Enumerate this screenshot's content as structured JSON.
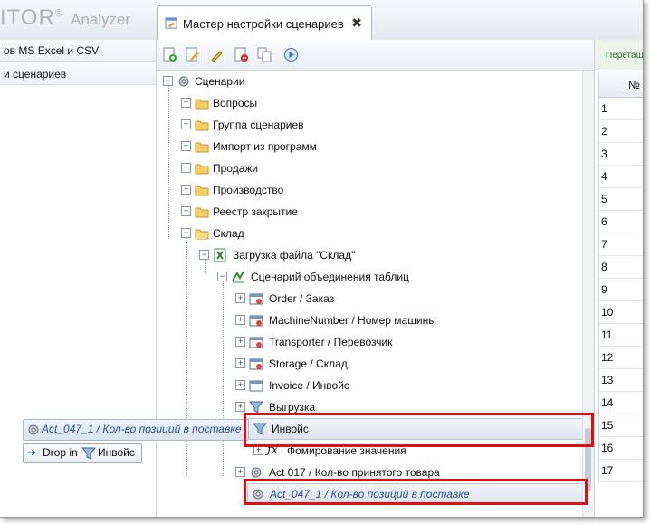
{
  "app": {
    "logo_text": "ITOR",
    "logo_mark": "®",
    "logo_sub": "Analyzer"
  },
  "tab": {
    "label": "Мастер настройки сценариев",
    "close": "✖"
  },
  "left_panel": {
    "items": [
      "ов MS Excel и CSV",
      "и сценариев"
    ]
  },
  "toolbar": {
    "buttons": [
      "add-icon",
      "edit-icon",
      "comment-icon",
      "delete-icon",
      "copy-icon",
      "run-icon"
    ]
  },
  "tree": {
    "root": "Сценарии",
    "folders": [
      "Вопросы",
      "Группа сценариев",
      "Импорт из программ",
      "Продажи",
      "Производство",
      "Реестр закрытие",
      "Склад"
    ],
    "sklad_children": {
      "load": "Загрузка файла \"Склад\"",
      "join": "Сценарий объединения таблиц",
      "tables": [
        "Order / Заказ",
        "MachineNumber / Номер машины",
        "Transporter / Перевозчик",
        "Storage / Склад",
        "Invoice / Инвойс",
        "Выгрузка"
      ],
      "selected": "Инвойс",
      "formula": "Фомирование значения",
      "act017": "Act 017 / Кол-во принятого товара",
      "act047": "Act_047_1 / Кол-во позиций в поставке"
    }
  },
  "drag": {
    "ghost": "Act_047_1 / Кол-во позиций в поставке",
    "drop_prefix": "Drop in",
    "drop_target": "Инвойс"
  },
  "right_panel": {
    "header": "Перетащ",
    "col": "№",
    "rows": [
      "1",
      "2",
      "3",
      "4",
      "5",
      "6",
      "7",
      "8",
      "9",
      "10",
      "11",
      "12",
      "13",
      "14",
      "15",
      "16",
      "17"
    ]
  },
  "colors": {
    "highlight": "#e01010",
    "accent_blue": "#2a4f9a"
  }
}
